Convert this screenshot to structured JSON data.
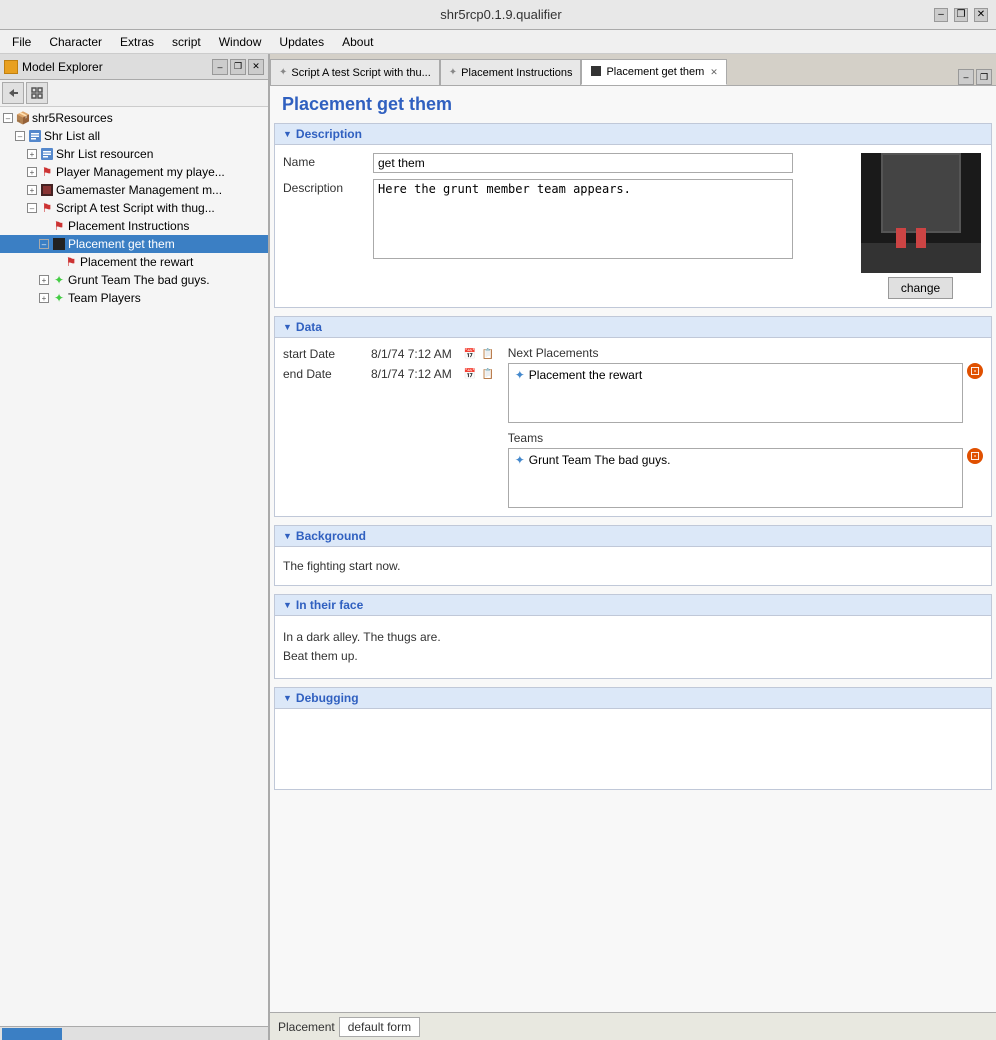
{
  "window": {
    "title": "shr5rcp0.1.9.qualifier",
    "controls": {
      "minimize": "–",
      "restore": "❐",
      "close": "✕"
    }
  },
  "menu": {
    "items": [
      "File",
      "Character",
      "Extras",
      "script",
      "Window",
      "Updates",
      "About"
    ]
  },
  "left_panel": {
    "title": "Model Explorer",
    "close_char": "✕",
    "minimize_char": "–",
    "restore_char": "❐",
    "toolbar": {
      "btn1": "↩",
      "btn2": "⊞"
    },
    "tree": [
      {
        "level": 0,
        "expand": "–",
        "icon": "📦",
        "icon_color": "#e8a020",
        "label": "shr5Resources",
        "selected": false
      },
      {
        "level": 1,
        "expand": "–",
        "icon": "📋",
        "label": "Shr List all",
        "selected": false
      },
      {
        "level": 2,
        "expand": "+",
        "icon": "📋",
        "label": "Shr List resourcen",
        "selected": false
      },
      {
        "level": 2,
        "expand": "+",
        "icon": "🔴",
        "label": "Player Management my playe...",
        "selected": false
      },
      {
        "level": 2,
        "expand": "+",
        "icon": "🟥",
        "label": "Gamemaster Management m...",
        "selected": false
      },
      {
        "level": 2,
        "expand": "–",
        "icon": "🔴",
        "label": "Script A test Script with thug...",
        "selected": false
      },
      {
        "level": 3,
        "expand": "",
        "icon": "🔴",
        "label": "Placement Instructions",
        "selected": false
      },
      {
        "level": 3,
        "expand": "–",
        "icon": "⬛",
        "label": "Placement get them",
        "selected": true
      },
      {
        "level": 4,
        "expand": "",
        "icon": "🔴",
        "label": "Placement the rewart",
        "selected": false
      },
      {
        "level": 3,
        "expand": "+",
        "icon": "💚",
        "label": "Grunt Team The bad guys.",
        "selected": false
      },
      {
        "level": 3,
        "expand": "+",
        "icon": "💚",
        "label": "Team Players",
        "selected": false
      }
    ]
  },
  "tabs": [
    {
      "label": "Script A test Script with thu...",
      "icon": "✦",
      "active": false
    },
    {
      "label": "Placement Instructions",
      "icon": "✦",
      "active": false
    },
    {
      "label": "Placement get them",
      "icon": "⬛",
      "active": true,
      "close": "✕"
    }
  ],
  "content": {
    "page_title": "Placement get them",
    "sections": {
      "description": {
        "header": "Description",
        "collapse_icon": "▼",
        "name_label": "Name",
        "name_value": "get them",
        "desc_label": "Description",
        "desc_value": "Here the grunt member team appears.",
        "change_btn": "change"
      },
      "data": {
        "header": "Data",
        "collapse_icon": "▼",
        "start_date_label": "start Date",
        "start_date_value": "8/1/74 7:12 AM",
        "end_date_label": "end Date",
        "end_date_value": "8/1/74 7:12 AM",
        "next_placements_title": "Next Placements",
        "next_placements": [
          {
            "icon": "✦",
            "text": "Placement the rewart"
          }
        ],
        "teams_title": "Teams",
        "teams": [
          {
            "icon": "✦",
            "text": "Grunt Team The bad guys."
          }
        ]
      },
      "background": {
        "header": "Background",
        "collapse_icon": "▼",
        "text": "The fighting start now."
      },
      "in_their_face": {
        "header": "In their face",
        "collapse_icon": "▼",
        "line1": "In a dark alley. The thugs are.",
        "line2": "Beat them up."
      },
      "debugging": {
        "header": "Debugging",
        "collapse_icon": "▼"
      }
    }
  },
  "status_bar": {
    "label": "Placement",
    "value": "default form"
  }
}
